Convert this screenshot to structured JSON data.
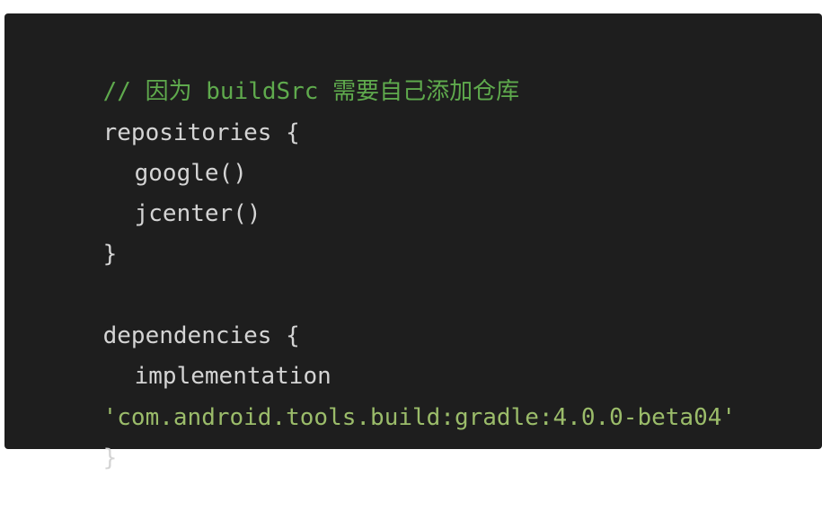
{
  "code": {
    "comment": "// 因为 buildSrc 需要自己添加仓库",
    "repositories_open": "repositories {",
    "google": "google()",
    "jcenter": "jcenter()",
    "close_brace_1": "}",
    "dependencies_open": "dependencies {",
    "implementation": "implementation",
    "dependency_string": "'com.android.tools.build:gradle:4.0.0-beta04'",
    "close_brace_2": "}"
  },
  "colors": {
    "background": "#1e1e1e",
    "text": "#d4d4d4",
    "comment": "#5faa4d",
    "string": "#9bbc6a"
  }
}
